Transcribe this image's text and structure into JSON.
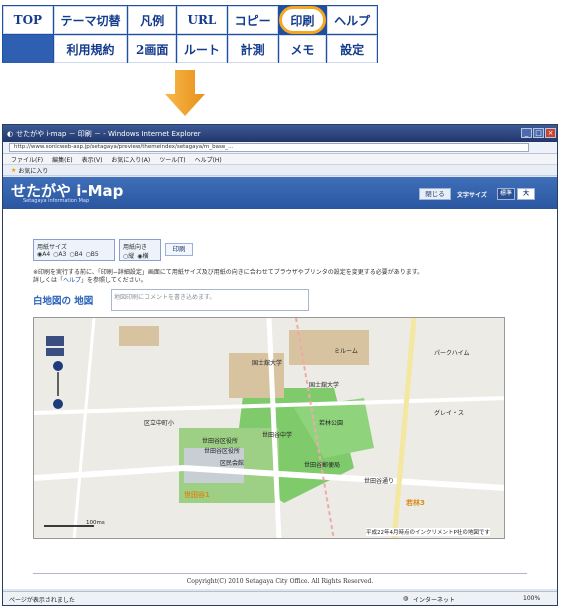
{
  "menu": {
    "row1": [
      "TOP",
      "テーマ切替",
      "凡例",
      "URL",
      "コピー",
      "印刷",
      "ヘルプ"
    ],
    "row2": [
      "利用規約",
      "2画面",
      "ルート",
      "計測",
      "メモ",
      "設定"
    ],
    "highlighted": "印刷",
    "highlight_color": "#f5a623"
  },
  "arrow": {
    "icon": "down-arrow-icon",
    "color": "#f5a623"
  },
  "window": {
    "title": "せたがや i-map － 印刷 － - Windows Internet Explorer",
    "address": "http://www.sonicweb-asp.jp/setagaya/preview/themeindex/setagaya/m_base_…",
    "menubar": [
      "ファイル(F)",
      "編集(E)",
      "表示(V)",
      "お気に入り(A)",
      "ツール(T)",
      "ヘルプ(H)"
    ],
    "favorites": "お気に入り",
    "status_left": "ページが表示されました",
    "zone": "インターネット",
    "zoom": "100%"
  },
  "page": {
    "logo": "せたがや i-Map",
    "logo_sub": "Setagaya information Map",
    "close_label": "閉じる",
    "font_size_label": "文字サイズ",
    "font_size_options": [
      "標準",
      "大"
    ],
    "paper_size": {
      "label": "用紙サイズ",
      "options": [
        "A4",
        "A3",
        "B4",
        "B5"
      ],
      "selected": "A4"
    },
    "orientation": {
      "label": "用紙向き",
      "options": [
        "縦",
        "横"
      ],
      "selected": "横"
    },
    "print_label": "印刷",
    "notice_line1": "※印刷を実行する前に、「印刷−詳細設定」画面にて用紙サイズ及び用紙の向きに合わせてブラウザやプリンタの設定を変更する必要があります。",
    "notice_line2a": "詳しくは「",
    "notice_link": "ヘルプ",
    "notice_line2b": "」を参照してください。",
    "map_title": "白地図の 地図",
    "comment_placeholder": "地図印刷にコメントを書き込めます。",
    "copyright": "Copyright(C) 2010 Setagaya City Office. All Rights Reserved."
  },
  "map": {
    "labels": [
      "国士舘大学",
      "ミルーム",
      "国士舘大学",
      "世田谷区役所",
      "世田谷中学",
      "区民会館",
      "世田谷区役所",
      "世田谷郵便局",
      "区立中町小",
      "若林公園",
      "パークハイム",
      "世田谷通り",
      "グレイ・ス"
    ],
    "scale_label": "100ms",
    "date_note": "平成22年4月時点のインクリメントP社の地図です",
    "accent_labels": [
      "世田谷1",
      "若林3"
    ]
  }
}
